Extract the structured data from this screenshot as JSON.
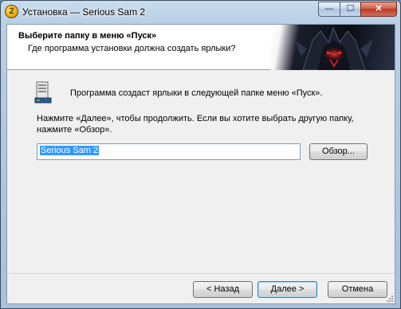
{
  "window": {
    "title": "Установка — Serious Sam 2",
    "app_icon_glyph": "2",
    "controls": {
      "minimize": "—",
      "maximize": "☐",
      "close": "✕"
    }
  },
  "header": {
    "title": "Выберите папку в меню «Пуск»",
    "subtitle": "Где программа установки должна создать ярлыки?"
  },
  "content": {
    "icon": "start-menu-folder-icon",
    "info": "Программа создаст ярлыки в следующей папке меню «Пуск».",
    "hint": "Нажмите «Далее», чтобы продолжить. Если вы хотите выбрать другую папку, нажмите «Обзор».",
    "folder_value": "Serious Sam 2",
    "browse_label": "Обзор..."
  },
  "footer": {
    "back_label": "< Назад",
    "next_label": "Далее >",
    "cancel_label": "Отмена"
  },
  "colors": {
    "selection": "#3399ff",
    "header_bg": "#ffffff",
    "dialog_bg": "#f0f0f0",
    "close_button": "#c4452a"
  }
}
